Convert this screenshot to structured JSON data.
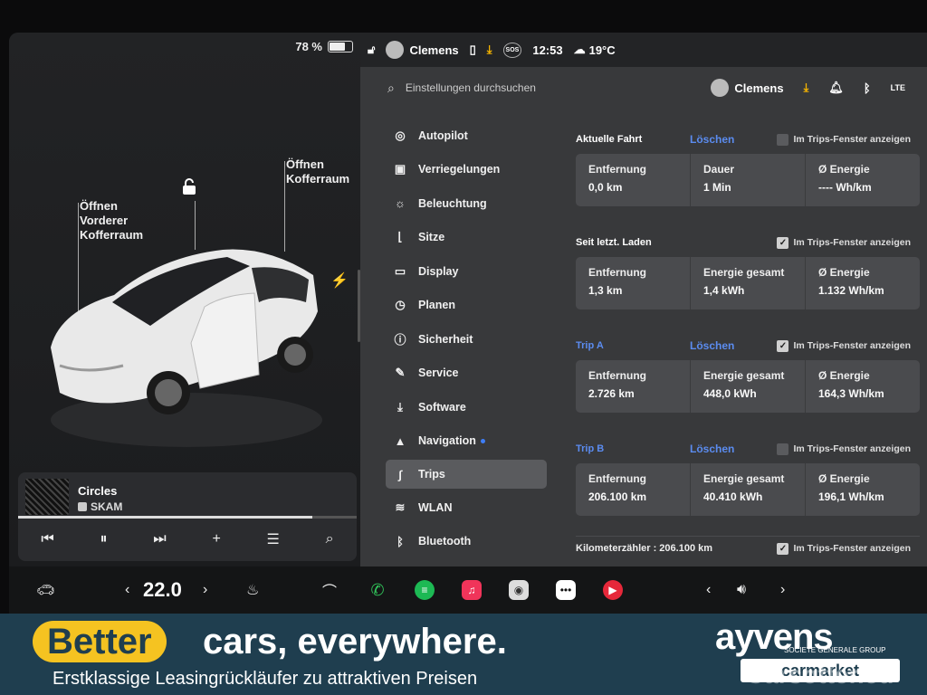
{
  "status": {
    "battery": "78 %",
    "battery_level": 0.78
  },
  "car": {
    "frunk_label": "Öffnen\nVorderer\nKofferraum",
    "trunk_label": "Öffnen\nKofferraum",
    "lock_icon": "unlock-icon",
    "charge_icon": "charge-port-icon"
  },
  "media": {
    "track": "Circles",
    "artist": "SKAM",
    "progress": 0.87
  },
  "topbar": {
    "driver": "Clemens",
    "time": "12:53",
    "weather": "19°C",
    "sos": "SOS"
  },
  "search": {
    "placeholder": "Einstellungen durchsuchen",
    "profile": "Clemens"
  },
  "nav": [
    {
      "label": "Autopilot",
      "icon": "steering-wheel-icon"
    },
    {
      "label": "Verriegelungen",
      "icon": "lock-icon"
    },
    {
      "label": "Beleuchtung",
      "icon": "light-icon"
    },
    {
      "label": "Sitze",
      "icon": "seat-icon"
    },
    {
      "label": "Display",
      "icon": "display-icon"
    },
    {
      "label": "Planen",
      "icon": "clock-icon"
    },
    {
      "label": "Sicherheit",
      "icon": "info-icon"
    },
    {
      "label": "Service",
      "icon": "wrench-icon"
    },
    {
      "label": "Software",
      "icon": "download-icon"
    },
    {
      "label": "Navigation",
      "icon": "navigation-icon"
    },
    {
      "label": "Trips",
      "icon": "trips-icon"
    },
    {
      "label": "WLAN",
      "icon": "wifi-icon"
    },
    {
      "label": "Bluetooth",
      "icon": "bluetooth-icon"
    }
  ],
  "trips": {
    "show_label": "Im Trips-Fenster anzeigen",
    "reset_label": "Löschen",
    "current": {
      "title": "Aktuelle Fahrt",
      "checked": false,
      "cells": [
        {
          "label": "Entfernung",
          "value": "0,0 km"
        },
        {
          "label": "Dauer",
          "value": "1 Min"
        },
        {
          "label": "Ø Energie",
          "value": "---- Wh/km"
        }
      ]
    },
    "since_charge": {
      "title": "Seit letzt. Laden",
      "checked": true,
      "cells": [
        {
          "label": "Entfernung",
          "value": "1,3 km"
        },
        {
          "label": "Energie gesamt",
          "value": "1,4 kWh"
        },
        {
          "label": "Ø Energie",
          "value": "1.132 Wh/km"
        }
      ]
    },
    "trip_a": {
      "title": "Trip A",
      "checked": true,
      "cells": [
        {
          "label": "Entfernung",
          "value": "2.726 km"
        },
        {
          "label": "Energie gesamt",
          "value": "448,0 kWh"
        },
        {
          "label": "Ø Energie",
          "value": "164,3 Wh/km"
        }
      ]
    },
    "trip_b": {
      "title": "Trip B",
      "checked": false,
      "cells": [
        {
          "label": "Entfernung",
          "value": "206.100 km"
        },
        {
          "label": "Energie gesamt",
          "value": "40.410 kWh"
        },
        {
          "label": "Ø Energie",
          "value": "196,1 Wh/km"
        }
      ]
    },
    "odometer": {
      "text": "Kilometerzähler : 206.100 km",
      "checked": true
    }
  },
  "dock": {
    "temperature": "22.0"
  },
  "banner": {
    "pill": "Better",
    "headline": "cars, everywhere.",
    "subline": "Erstklassige Leasingrückläufer zu attraktiven Preisen",
    "brand": "ayvens",
    "brand_sub": "SOCIETE GENERALE GROUP",
    "partner": "carmarket",
    "watermark": "Carsotter.eu",
    "colors": {
      "navy": "#1f3e4f",
      "yellow": "#f5c321"
    }
  }
}
